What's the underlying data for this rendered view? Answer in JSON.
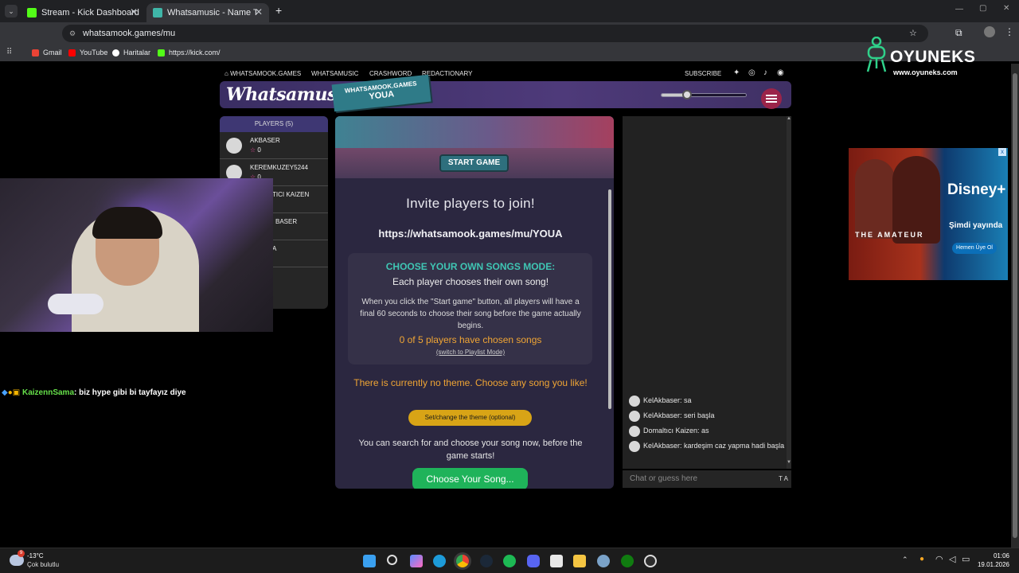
{
  "browser": {
    "tabs": [
      {
        "title": "Stream - Kick Dashboard",
        "favicon_color": "#53fc18"
      },
      {
        "title": "Whatsamusic - Name That Tun",
        "favicon_color": "#3fb6a8"
      }
    ],
    "new_tab": "+",
    "url": "whatsamook.games/mu",
    "bookmarks": [
      {
        "label": "Gmail",
        "color": "#ea4335"
      },
      {
        "label": "YouTube",
        "color": "#ff0000"
      },
      {
        "label": "Haritalar",
        "color": "#34a853"
      },
      {
        "label": "https://kick.com/",
        "color": "#53fc18"
      }
    ]
  },
  "site_nav": {
    "home": "WHATSAMOOK.GAMES",
    "links": [
      "WHATSAMUSIC",
      "CRASHWORD",
      "REDACTIONARY"
    ],
    "subscribe": "SUBSCRIBE"
  },
  "header": {
    "logo": "Whatsamusic",
    "badge_top": "WHATSAMOOK.GAMES",
    "badge_code": "YOUA",
    "volume": 0.3
  },
  "players": {
    "heading": "PLAYERS (5)",
    "list": [
      {
        "name": "AKBASER",
        "score": "0"
      },
      {
        "name": "KEREMKUZEY5244",
        "score": "0"
      },
      {
        "name": "TICI KAIZEN",
        "score": ""
      },
      {
        "name": "BASER",
        "score": ""
      },
      {
        "name": "A",
        "score": ""
      }
    ]
  },
  "stream_chat": {
    "user": "KaizennSama",
    "message": ": biz hype gibi bi tayfayız diye"
  },
  "game": {
    "start_button": "START GAME",
    "invite_title": "Invite players to join!",
    "invite_url": "https://whatsamook.games/mu/YOUA",
    "mode_title": "CHOOSE YOUR OWN SONGS MODE:",
    "mode_subtitle": "Each player chooses their own song!",
    "mode_description": "When you click the \"Start game\" button, all players will have a final 60 seconds to choose their song before the game actually begins.",
    "chosen_status": "0 of 5 players have chosen songs",
    "switch_link": "(switch to Playlist Mode)",
    "theme_text": "There is currently no theme. Choose any song you like!",
    "theme_button": "Set/change the theme (optional)",
    "search_text": "You can search for and choose your song now, before the game starts!",
    "choose_button": "Choose Your Song..."
  },
  "chat": {
    "messages": [
      "KelAkbaser: sa",
      "KelAkbaser: seri başla",
      "Domaltıcı Kaizen: as",
      "KelAkbaser: kardeşim caz yapma hadi başla"
    ],
    "placeholder": "Chat or guess here",
    "tools": "T A"
  },
  "ad": {
    "title": "THE AMATEUR",
    "brand": "Disney+",
    "now": "Şimdi yayında",
    "cta": "Hemen Üye Ol",
    "close": "x"
  },
  "watermark": {
    "name": "OYUNEKS",
    "url": "www.oyuneks.com"
  },
  "taskbar": {
    "weather_badge": "9",
    "temperature": "-13°C",
    "weather_desc": "Çok bulutlu",
    "time": "01:06",
    "date": "19.01.2026"
  }
}
